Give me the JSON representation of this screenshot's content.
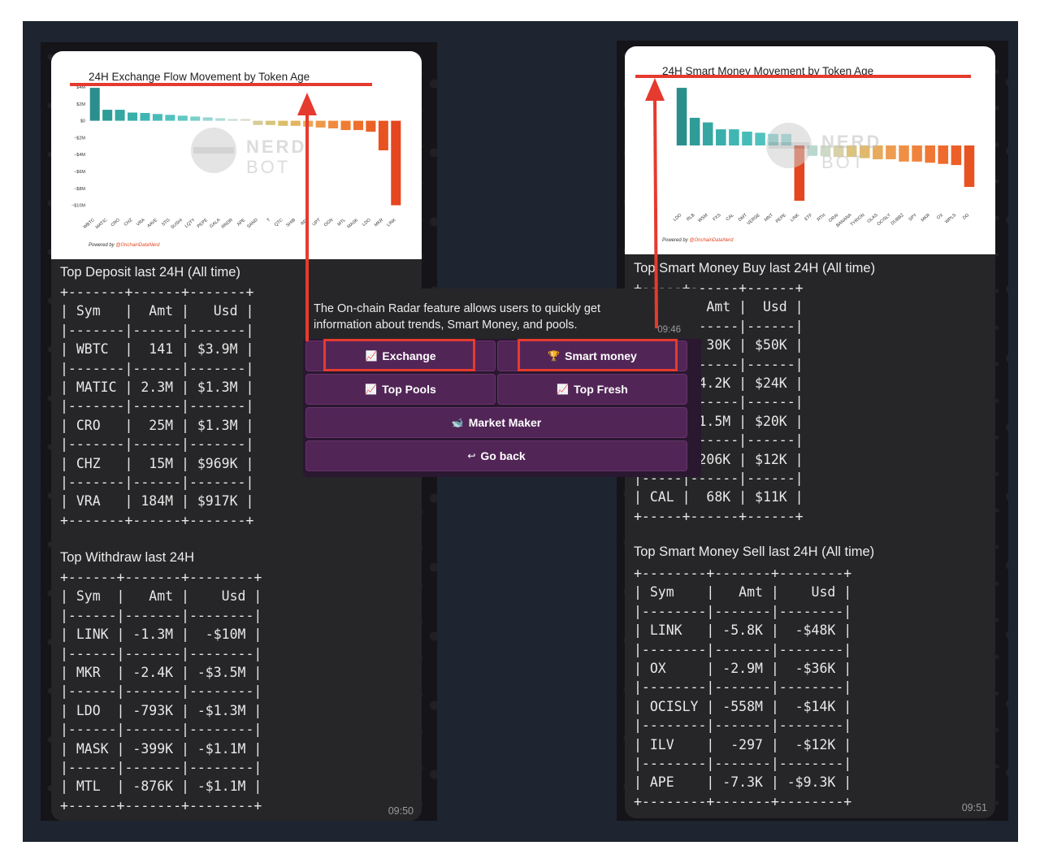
{
  "left_message": {
    "chart_data": {
      "type": "bar",
      "title": "24H Exchange Flow Movement by Token Age",
      "y_ticks": [
        "$4M",
        "$2M",
        "$0",
        "−$2M",
        "−$4M",
        "−$6M",
        "−$8M",
        "−$10M"
      ],
      "ylim": [
        -11,
        4
      ],
      "categories": [
        "WBTC",
        "MATIC",
        "CRO",
        "CHZ",
        "VRA",
        "AAVE",
        "STG",
        "SUSHI",
        "LQTY",
        "PEPE",
        "GALA",
        "RNDR",
        "APE",
        "SAND",
        "T",
        "QTC",
        "SHIB",
        "IMX",
        "UPT",
        "OGN",
        "MTL",
        "MASK",
        "LDO",
        "MKR",
        "LINK"
      ],
      "values": [
        3.9,
        1.3,
        1.3,
        0.97,
        0.92,
        0.8,
        0.7,
        0.6,
        0.5,
        0.4,
        0.3,
        0.2,
        0.2,
        -0.5,
        -0.5,
        -0.6,
        -0.6,
        -0.7,
        -0.8,
        -0.9,
        -1.1,
        -1.1,
        -1.3,
        -3.5,
        -10
      ],
      "colors": [
        "#2a8f8c",
        "#2f9c98",
        "#36a6a2",
        "#3aaeab",
        "#3fb6b3",
        "#46bcb8",
        "#52c2be",
        "#62c8c4",
        "#78cfcb",
        "#94d6d2",
        "#acdcd7",
        "#c2dcd2",
        "#d8d6c4",
        "#d6cc96",
        "#d7c47c",
        "#dcbd6a",
        "#e3b460",
        "#eaa555",
        "#ee984a",
        "#f08a3d",
        "#f07c33",
        "#ef6e2c",
        "#ec6126",
        "#e85322",
        "#e5451f"
      ],
      "watermark": [
        "NERD",
        "BOT"
      ],
      "credit_prefix": "Powered by ",
      "credit_handle": "@OnchainDataNerd"
    },
    "deposit_title": "Top Deposit last 24H (All time)",
    "deposit_table": "+-------+------+-------+\n| Sym   |  Amt |   Usd |\n|-------|------|-------|\n| WBTC  |  141 | $3.9M |\n|-------|------|-------|\n| MATIC | 2.3M | $1.3M |\n|-------|------|-------|\n| CRO   |  25M | $1.3M |\n|-------|------|-------|\n| CHZ   |  15M | $969K |\n|-------|------|-------|\n| VRA   | 184M | $917K |\n+-------+------+-------+",
    "withdraw_title": "Top Withdraw last 24H",
    "withdraw_table": "+------+-------+--------+\n| Sym  |   Amt |    Usd |\n|------|-------|--------|\n| LINK | -1.3M |  -$10M |\n|------|-------|--------|\n| MKR  | -2.4K | -$3.5M |\n|------|-------|--------|\n| LDO  | -793K | -$1.3M |\n|------|-------|--------|\n| MASK | -399K | -$1.1M |\n|------|-------|--------|\n| MTL  | -876K | -$1.1M |\n+------+-------+--------+",
    "time": "09:50"
  },
  "right_message": {
    "chart_data": {
      "type": "bar",
      "title": "24H Smart Money Movement by Token Age",
      "ylim": [
        -55,
        55
      ],
      "categories": [
        "LDO",
        "RLB",
        "WSM",
        "FXS",
        "CAL",
        "DMT",
        "VERSE",
        "MNT",
        "PEPE",
        "LINK",
        "ETF",
        "RTH",
        "ORAI",
        "BANANA",
        "TYRION",
        "OLAS",
        "OCISLY",
        "DUBBZ",
        "SPY",
        "MKR",
        "OX",
        "WPLS",
        "DG"
      ],
      "values": [
        50,
        24,
        20,
        14,
        14,
        12,
        11,
        10,
        10,
        -48,
        -9,
        -9.3,
        -10,
        -10,
        -11,
        -12,
        -12,
        -14,
        -14,
        -15,
        -16,
        -17,
        -36
      ],
      "colors": [
        "#2a8f8c",
        "#2f9c98",
        "#36a6a2",
        "#3aaeab",
        "#3fb6b3",
        "#46bcb8",
        "#52c2be",
        "#62c8c4",
        "#78cfcb",
        "#e5451f",
        "#b8d8ce",
        "#cedac8",
        "#d8d1a8",
        "#dcc47e",
        "#e2b86a",
        "#e8aa5c",
        "#ed9c50",
        "#ef8f46",
        "#f0833c",
        "#f07734",
        "#ee6b2d",
        "#ec5f27",
        "#e85322"
      ],
      "watermark": [
        "NERD",
        "BOT"
      ],
      "credit_prefix": "Powered by ",
      "credit_handle": "@OnchainDataNerd"
    },
    "buy_title": "Top Smart Money Buy last 24H (All time)",
    "buy_table": "+-----+------+------+\n| Sym |  Amt |  Usd |\n|-----|------|------|\n| LDO |  30K | $50K |\n|-----|------|------|\n| RLB | 4.2K | $24K |\n|-----|------|------|\n| WSM | 1.5M | $20K |\n|-----|------|------|\n| FXS | 206K | $12K |\n|-----|------|------|\n| CAL |  68K | $11K |\n+-----+------+------+",
    "sell_title": "Top Smart Money Sell last 24H (All time)",
    "sell_table": "+--------+-------+--------+\n| Sym    |   Amt |    Usd |\n|--------|-------|--------|\n| LINK   | -5.8K |  -$48K |\n|--------|-------|--------|\n| OX     | -2.9M |  -$36K |\n|--------|-------|--------|\n| OCISLY | -558M |  -$14K |\n|--------|-------|--------|\n| ILV    |  -297 |  -$12K |\n|--------|-------|--------|\n| APE    | -7.3K | -$9.3K |\n+--------+-------+--------+",
    "time": "09:51"
  },
  "keyboard": {
    "message": "The On-chain Radar feature allows users to quickly get information about trends, Smart Money, and pools.",
    "time": "09:46",
    "buttons": {
      "exchange": {
        "icon": "📈",
        "label": "Exchange"
      },
      "smart_money": {
        "icon": "🏆",
        "label": "Smart money"
      },
      "top_pools": {
        "icon": "📈",
        "label": "Top Pools"
      },
      "top_fresh": {
        "icon": "📈",
        "label": "Top Fresh"
      },
      "market_maker": {
        "icon": "🐋",
        "label": "Market Maker"
      },
      "go_back": {
        "icon": "↩",
        "label": "Go back"
      }
    }
  },
  "annotation": {
    "color": "#e53b2e"
  }
}
